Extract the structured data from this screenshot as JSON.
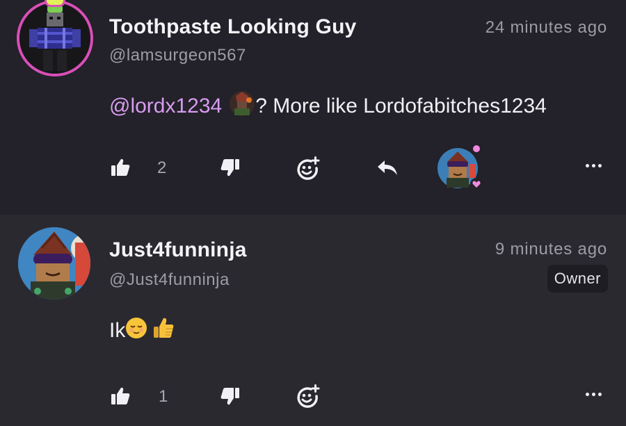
{
  "comments": [
    {
      "display_name": "Toothpaste Looking Guy",
      "handle": "@lamsurgeon567",
      "time": "24 minutes ago",
      "mention": "@lordx1234",
      "body_rest": "? More like Lordofabitches1234",
      "likes": "2"
    },
    {
      "display_name": "Just4funninja",
      "handle": "@Just4funninja",
      "time": "9 minutes ago",
      "badge": "Owner",
      "body_text": "Ik",
      "likes": "1"
    }
  ],
  "colors": {
    "background": "#232129",
    "second_comment_bg": "#2b2930",
    "mention": "#d79cf0",
    "avatar_ring": "#d94fb7",
    "reaction_heart": "#f08ae0"
  },
  "icons": [
    "like-icon",
    "dislike-icon",
    "add-reaction-icon",
    "reply-icon",
    "more-options-icon",
    "reacted-user-avatar",
    "heart-icon"
  ]
}
